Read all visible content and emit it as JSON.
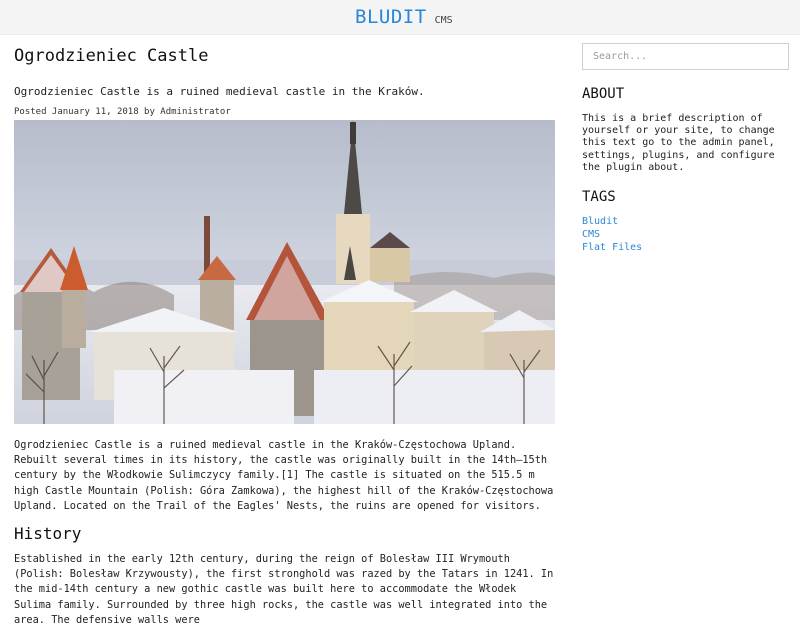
{
  "header": {
    "site_title": "BLUDIT",
    "site_slogan": "CMS"
  },
  "post": {
    "title": "Ogrodzieniec Castle",
    "lead": "Ogrodzieniec Castle is a ruined medieval castle in the Kraków.",
    "meta": "Posted January 11, 2018 by Administrator",
    "body": "Ogrodzieniec Castle is a ruined medieval castle in the Kraków-Częstochowa Upland. Rebuilt several times in its history, the castle was originally built in the 14th–15th century by the Włodkowie Sulimczycy family.[1] The castle is situated on the 515.5 m high Castle Mountain (Polish: Góra Zamkowa), the highest hill of the Kraków-Częstochowa Upland. Located on the Trail of the Eagles' Nests, the ruins are opened for visitors.",
    "history_heading": "History",
    "history_body": "Established in the early 12th century, during the reign of Bolesław III Wrymouth (Polish: Bolesław Krzywousty), the first stronghold was razed by the Tatars in 1241. In the mid-14th century a new gothic castle was built here to accommodate the Włodek Sulima family. Surrounded by three high rocks, the castle was well integrated into the area. The defensive walls were"
  },
  "sidebar": {
    "search_placeholder": "Search...",
    "about_heading": "ABOUT",
    "about_text": "This is a brief description of yourself or your site, to change this text go to the admin panel, settings, plugins, and configure the plugin about.",
    "tags_heading": "TAGS",
    "tags": [
      "Bludit",
      "CMS",
      "Flat Files"
    ]
  },
  "colors": {
    "brand": "#2a86d8",
    "link": "#2a86d8",
    "header_bg": "#f4f4f4"
  }
}
